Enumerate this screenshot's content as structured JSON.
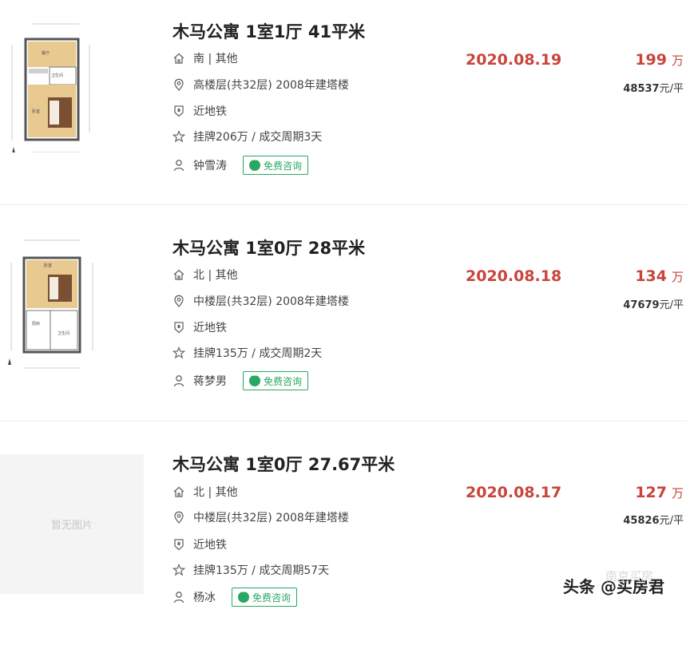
{
  "listings": [
    {
      "title": "木马公寓 1室1厅 41平米",
      "orientation": "南 | 其他",
      "floor": "高楼层(共32层) 2008年建塔楼",
      "subway": "近地铁",
      "deal": "挂牌206万 / 成交周期3天",
      "agent": "钟雪涛",
      "consult_label": "免费咨询",
      "date": "2020.08.19",
      "price": "199",
      "price_unit": "万",
      "unit_price": "48537",
      "unit_price_suffix": "元/平",
      "image": "floorplan"
    },
    {
      "title": "木马公寓 1室0厅 28平米",
      "orientation": "北 | 其他",
      "floor": "中楼层(共32层) 2008年建塔楼",
      "subway": "近地铁",
      "deal": "挂牌135万 / 成交周期2天",
      "agent": "蒋梦男",
      "consult_label": "免费咨询",
      "date": "2020.08.18",
      "price": "134",
      "price_unit": "万",
      "unit_price": "47679",
      "unit_price_suffix": "元/平",
      "image": "floorplan"
    },
    {
      "title": "木马公寓 1室0厅 27.67平米",
      "orientation": "北 | 其他",
      "floor": "中楼层(共32层) 2008年建塔楼",
      "subway": "近地铁",
      "deal": "挂牌135万 / 成交周期57天",
      "agent": "杨冰",
      "consult_label": "免费咨询",
      "date": "2020.08.17",
      "price": "127",
      "price_unit": "万",
      "unit_price": "45826",
      "unit_price_suffix": "元/平",
      "image": "none",
      "no_image_text": "暂无图片"
    }
  ],
  "watermark": {
    "text": "头条 @买房君",
    "sub": "南京买房"
  },
  "colors": {
    "accent_red": "#c9453b",
    "consult_green": "#2aa863"
  }
}
